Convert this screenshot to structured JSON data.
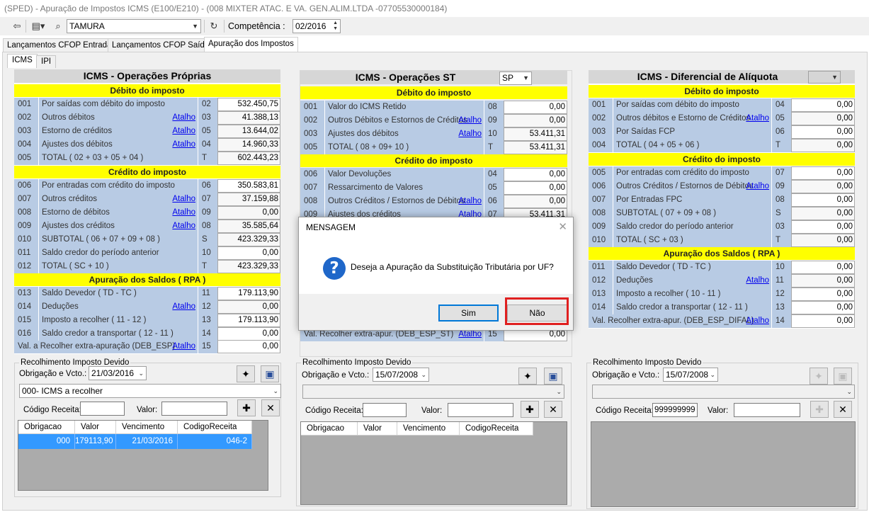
{
  "window": {
    "title": "(SPED) - Apuração de Impostos ICMS (E100/E210) -   (008 MIXTER ATAC. E VA. GEN.ALIM.LTDA   -07705530000184)"
  },
  "toolbar": {
    "company": "TAMURA",
    "competencia_label": "Competência :",
    "competencia_value": "02/2016"
  },
  "tabs": [
    "Lançamentos CFOP Entrada",
    "Lançamentos CFOP Saída",
    "Apuração dos Impostos"
  ],
  "subtabs": [
    "ICMS",
    "IPI"
  ],
  "link_text": "Atalho",
  "proprias": {
    "title": "ICMS - Operações Próprias",
    "sec_debito": "Débito do imposto",
    "sec_credito": "Crédito do imposto",
    "sec_saldos": "Apuração dos Saldos ( RPA )",
    "rows": [
      {
        "code": "001",
        "desc": "Por saídas com débito do imposto",
        "link": false,
        "line": "02",
        "value": "532.450,75"
      },
      {
        "code": "002",
        "desc": "Outros débitos",
        "link": true,
        "line": "03",
        "value": "41.388,13"
      },
      {
        "code": "003",
        "desc": "Estorno de créditos",
        "link": true,
        "line": "05",
        "value": "13.644,02"
      },
      {
        "code": "004",
        "desc": "Ajustes dos débitos",
        "link": true,
        "line": "04",
        "value": "14.960,33"
      },
      {
        "code": "005",
        "desc": "TOTAL ( 02 + 03 + 05 + 04 )",
        "link": false,
        "line": "T",
        "value": "602.443,23"
      },
      {
        "code": "006",
        "desc": "Por entradas com crédito do imposto",
        "link": false,
        "line": "06",
        "value": "350.583,81"
      },
      {
        "code": "007",
        "desc": "Outros créditos",
        "link": true,
        "line": "07",
        "value": "37.159,88"
      },
      {
        "code": "008",
        "desc": "Estorno de débitos",
        "link": true,
        "line": "09",
        "value": "0,00"
      },
      {
        "code": "009",
        "desc": "Ajustes dos créditos",
        "link": true,
        "line": "08",
        "value": "35.585,64"
      },
      {
        "code": "010",
        "desc": "SUBTOTAL ( 06 + 07 + 09 + 08 )",
        "link": false,
        "line": "S",
        "value": "423.329,33"
      },
      {
        "code": "011",
        "desc": "Saldo credor do período anterior",
        "link": false,
        "line": "10",
        "value": "0,00"
      },
      {
        "code": "012",
        "desc": "TOTAL ( SC + 10 )",
        "link": false,
        "line": "T",
        "value": "423.329,33"
      },
      {
        "code": "013",
        "desc": "Saldo Devedor ( TD - TC )",
        "link": false,
        "line": "11",
        "value": "179.113,90"
      },
      {
        "code": "014",
        "desc": "Deduções",
        "link": true,
        "line": "12",
        "value": "0,00"
      },
      {
        "code": "015",
        "desc": "Imposto a recolher ( 11 - 12 )",
        "link": false,
        "line": "13",
        "value": "179.113,90"
      },
      {
        "code": "016",
        "desc": "Saldo credor a transportar ( 12 - 11 )",
        "link": false,
        "line": "14",
        "value": "0,00"
      }
    ],
    "extra": {
      "desc": "Val. a Recolher extra-apuração (DEB_ESP)",
      "line": "15",
      "value": "0,00"
    }
  },
  "st": {
    "title": "ICMS - Operações ST",
    "uf": "SP",
    "sec_debito": "Débito do imposto",
    "sec_credito": "Crédito do imposto",
    "rows": [
      {
        "code": "001",
        "desc": "Valor do ICMS Retido",
        "link": false,
        "line": "08",
        "value": "0,00"
      },
      {
        "code": "002",
        "desc": "Outros Débitos e Estornos de Créditos",
        "link": true,
        "line": "09",
        "value": "0,00"
      },
      {
        "code": "003",
        "desc": "Ajustes dos débitos",
        "link": true,
        "line": "10",
        "value": "53.411,31"
      },
      {
        "code": "005",
        "desc": "TOTAL ( 08 + 09+ 10 )",
        "link": false,
        "line": "T",
        "value": "53.411,31"
      },
      {
        "code": "006",
        "desc": "Valor Devoluções",
        "link": false,
        "line": "04",
        "value": "0,00"
      },
      {
        "code": "007",
        "desc": "Ressarcimento de Valores",
        "link": false,
        "line": "05",
        "value": "0,00"
      },
      {
        "code": "008",
        "desc": "Outros Créditos / Estornos de Débitos",
        "link": true,
        "line": "06",
        "value": "0,00"
      },
      {
        "code": "009",
        "desc": "Ajustes dos créditos",
        "link": true,
        "line": "07",
        "value": "53.411,31"
      }
    ],
    "extra": {
      "desc": "Val. Recolher extra-apur. (DEB_ESP_ST)",
      "line": "15",
      "value": "0,00"
    }
  },
  "difal": {
    "title": "ICMS - Diferencial de Alíquota",
    "sec_debito": "Débito do imposto",
    "sec_credito": "Crédito do imposto",
    "sec_saldos": "Apuração dos Saldos ( RPA )",
    "rows": [
      {
        "code": "001",
        "desc": "Por saídas com débito do imposto",
        "link": false,
        "line": "04",
        "value": "0,00"
      },
      {
        "code": "002",
        "desc": "Outros débitos e Estorno de Créditos",
        "link": true,
        "line": "05",
        "value": "0,00"
      },
      {
        "code": "003",
        "desc": "Por Saídas FCP",
        "link": false,
        "line": "06",
        "value": "0,00"
      },
      {
        "code": "004",
        "desc": "TOTAL ( 04 + 05 + 06 )",
        "link": false,
        "line": "T",
        "value": "0,00"
      },
      {
        "code": "005",
        "desc": "Por entradas com crédito do imposto",
        "link": false,
        "line": "07",
        "value": "0,00"
      },
      {
        "code": "006",
        "desc": "Outros Créditos / Estornos de Débitos",
        "link": true,
        "line": "09",
        "value": "0,00"
      },
      {
        "code": "007",
        "desc": "Por Entradas FPC",
        "link": false,
        "line": "08",
        "value": "0,00"
      },
      {
        "code": "008",
        "desc": "SUBTOTAL ( 07 + 09 + 08 )",
        "link": false,
        "line": "S",
        "value": "0,00"
      },
      {
        "code": "009",
        "desc": "Saldo credor do período anterior",
        "link": false,
        "line": "03",
        "value": "0,00"
      },
      {
        "code": "010",
        "desc": "TOTAL ( SC + 03 )",
        "link": false,
        "line": "T",
        "value": "0,00"
      },
      {
        "code": "011",
        "desc": "Saldo Devedor ( TD - TC )",
        "link": false,
        "line": "10",
        "value": "0,00"
      },
      {
        "code": "012",
        "desc": "Deduções",
        "link": true,
        "line": "11",
        "value": "0,00"
      },
      {
        "code": "013",
        "desc": "Imposto a recolher ( 10 - 11 )",
        "link": false,
        "line": "12",
        "value": "0,00"
      },
      {
        "code": "014",
        "desc": "Saldo credor a transportar ( 12 - 11 )",
        "link": false,
        "line": "13",
        "value": "0,00"
      }
    ],
    "extra": {
      "desc": "Val. Recolher extra-apur. (DEB_ESP_DIFAL)",
      "line": "14",
      "value": "0,00"
    }
  },
  "recolhimento": {
    "group_title": "Recolhimento Imposto Devido",
    "obrig_label": "Obrigação e Vcto.:",
    "codigo_label": "Código Receita:",
    "valor_label": "Valor:",
    "columns": [
      "Obrigacao",
      "Valor",
      "Vencimento",
      "CodigoReceita"
    ],
    "proprias": {
      "date": "21/03/2016",
      "obrigacao": "000- ICMS a recolher",
      "codigo": "",
      "valor": "",
      "rows": [
        [
          "000",
          "179113,90",
          "21/03/2016",
          "046-2"
        ]
      ]
    },
    "st": {
      "date": "15/07/2008",
      "obrigacao": "",
      "codigo": "",
      "valor": ""
    },
    "difal": {
      "date": "15/07/2008",
      "obrigacao": "",
      "codigo": "999999999",
      "valor": ""
    }
  },
  "dialog": {
    "title": "MENSAGEM",
    "message": "Deseja a Apuração da Substituição Tributária por UF?",
    "yes": "Sim",
    "no": "Não"
  }
}
